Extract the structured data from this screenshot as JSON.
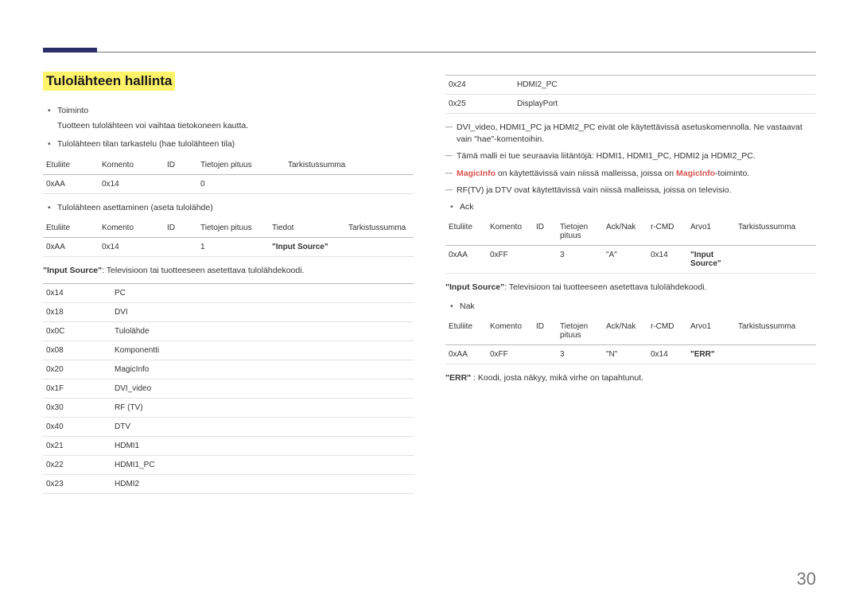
{
  "title": "Tulolähteen hallinta",
  "left": {
    "bullets": {
      "toiminto": "Toiminto",
      "toiminto_desc": "Tuotteen tulolähteen voi vaihtaa tietokoneen kautta.",
      "view_state": "Tulolähteen tilan tarkastelu (hae tulolähteen tila)",
      "set_source": "Tulolähteen asettaminen (aseta tulolähde)"
    },
    "table_headers": {
      "etuliite": "Etuliite",
      "komento": "Komento",
      "id": "ID",
      "tp": "Tietojen pituus",
      "tiedot": "Tiedot",
      "tarkistus": "Tarkistussumma"
    },
    "t1": {
      "r": [
        "0xAA",
        "0x14",
        "",
        "0",
        ""
      ]
    },
    "t2": {
      "r": [
        "0xAA",
        "0x14",
        "",
        "1",
        "\"Input Source\"",
        ""
      ]
    },
    "desc1_pre": "\"Input Source\"",
    "desc1_post": ": Televisioon tai tuotteeseen asetettava tulolähdekoodi.",
    "codes": [
      [
        "0x14",
        "PC"
      ],
      [
        "0x18",
        "DVI"
      ],
      [
        "0x0C",
        "Tulolähde"
      ],
      [
        "0x08",
        "Komponentti"
      ],
      [
        "0x20",
        "MagicInfo"
      ],
      [
        "0x1F",
        "DVI_video"
      ],
      [
        "0x30",
        "RF (TV)"
      ],
      [
        "0x40",
        "DTV"
      ],
      [
        "0x21",
        "HDMI1"
      ],
      [
        "0x22",
        "HDMI1_PC"
      ],
      [
        "0x23",
        "HDMI2"
      ]
    ]
  },
  "right": {
    "codes_cont": [
      [
        "0x24",
        "HDMI2_PC"
      ],
      [
        "0x25",
        "DisplayPort"
      ]
    ],
    "dash1": "DVI_video, HDMI1_PC ja HDMI2_PC eivät ole käytettävissä asetuskomennolla. Ne vastaavat vain \"hae\"-komentoihin.",
    "dash2": "Tämä malli ei tue seuraavia liitäntöjä: HDMI1, HDMI1_PC, HDMI2 ja HDMI2_PC.",
    "dash3_pre": "MagicInfo",
    "dash3_mid": " on käytettävissä vain niissä malleissa, joissa on ",
    "dash3_hl": "MagicInfo",
    "dash3_post": "-toiminto.",
    "dash4": "RF(TV) ja DTV ovat käytettävissä vain niissä malleissa, joissa on televisio.",
    "ack": "Ack",
    "nak": "Nak",
    "ack_headers": {
      "etuliite": "Etuliite",
      "komento": "Komento",
      "id": "ID",
      "tp": "Tietojen pituus",
      "acknak": "Ack/Nak",
      "rcmd": "r-CMD",
      "arvo1": "Arvo1",
      "tarkistus": "Tarkistussumma"
    },
    "ack_row": [
      "0xAA",
      "0xFF",
      "",
      "3",
      "\"A\"",
      "0x14",
      "\"Input Source\"",
      ""
    ],
    "nak_row": [
      "0xAA",
      "0xFF",
      "",
      "3",
      "\"N\"",
      "0x14",
      "\"ERR\"",
      ""
    ],
    "desc_after_ack_pre": "\"Input Source\"",
    "desc_after_ack_post": ": Televisioon tai tuotteeseen asetettava tulolähdekoodi.",
    "err_pre": "\"ERR\"",
    "err_post": " : Koodi, josta näkyy, mikä virhe on tapahtunut."
  },
  "page_number": "30"
}
